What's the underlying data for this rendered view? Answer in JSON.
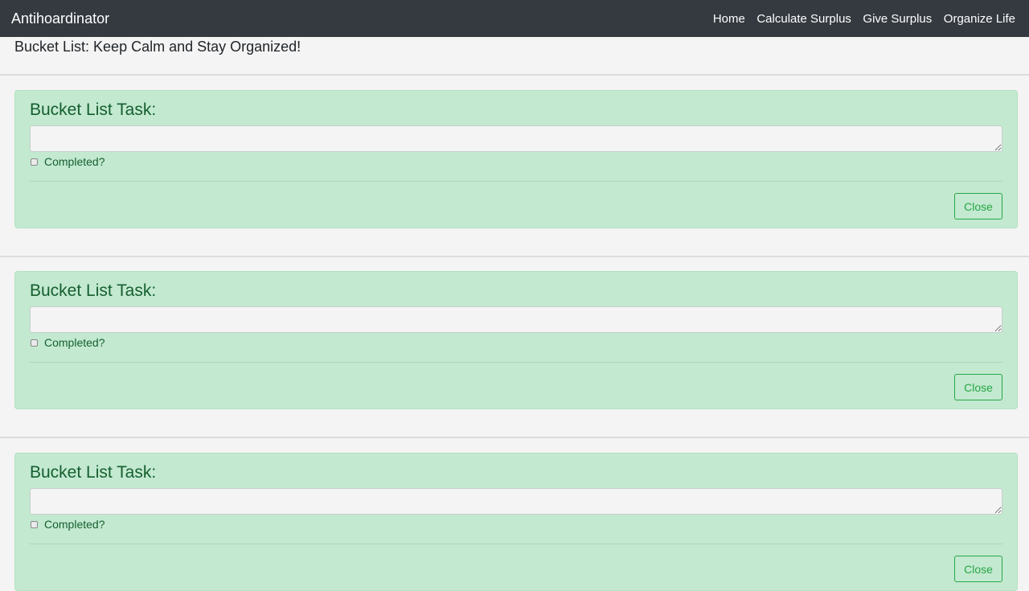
{
  "navbar": {
    "brand": "Antihoardinator",
    "links": [
      "Home",
      "Calculate Surplus",
      "Give Surplus",
      "Organize Life"
    ]
  },
  "page": {
    "heading": "Bucket List: Keep Calm and Stay Organized!"
  },
  "cards": [
    {
      "title": "Bucket List Task:",
      "task_value": "",
      "checkbox_label": "Completed?",
      "completed": false,
      "close_label": "Close"
    },
    {
      "title": "Bucket List Task:",
      "task_value": "",
      "checkbox_label": "Completed?",
      "completed": false,
      "close_label": "Close"
    },
    {
      "title": "Bucket List Task:",
      "task_value": "",
      "checkbox_label": "Completed?",
      "completed": false,
      "close_label": "Close"
    }
  ],
  "colors": {
    "navbar_bg": "#343a40",
    "card_bg": "#c3e9d1",
    "card_text": "#155f2e",
    "close_button": "#28a745"
  }
}
